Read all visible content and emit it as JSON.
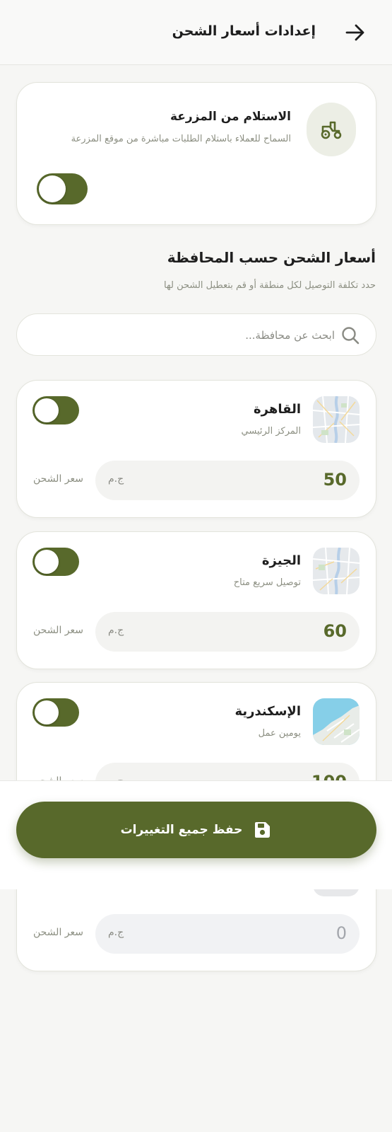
{
  "header": {
    "title": "إعدادات أسعار الشحن"
  },
  "pickup": {
    "title": "الاستلام من المزرعة",
    "subtitle": "السماح للعملاء باستلام الطلبات مباشرة من موقع المزرعة",
    "enabled": true
  },
  "section": {
    "title": "أسعار الشحن حسب المحافظة",
    "subtitle": "حدد تكلفة التوصيل لكل منطقة أو قم بتعطيل الشحن لها"
  },
  "search": {
    "placeholder": "ابحث عن محافظة..."
  },
  "governorates": [
    {
      "name": "القاهرة",
      "subtitle": "المركز الرئيسي",
      "price": "50",
      "currency": "ج.م",
      "price_label": "سعر الشحن",
      "enabled": true
    },
    {
      "name": "الجيزة",
      "subtitle": "توصيل سريع متاح",
      "price": "60",
      "currency": "ج.م",
      "price_label": "سعر الشحن",
      "enabled": true
    },
    {
      "name": "الإسكندرية",
      "subtitle": "يومين عمل",
      "price": "100",
      "currency": "ج.م",
      "price_label": "سعر الشحن",
      "enabled": true
    },
    {
      "name": "",
      "subtitle": "",
      "price": "0",
      "currency": "ج.م",
      "price_label": "سعر الشحن",
      "enabled": false
    }
  ],
  "save_button": {
    "label": "حفظ جميع التغييرات"
  },
  "colors": {
    "accent": "#58692b",
    "background": "#f6f6f4",
    "card": "#ffffff",
    "muted_text": "#8c8f82"
  },
  "icons": {
    "back": "arrow-right-icon",
    "pickup": "tractor-icon",
    "search": "search-icon",
    "save": "floppy-disk-icon"
  }
}
